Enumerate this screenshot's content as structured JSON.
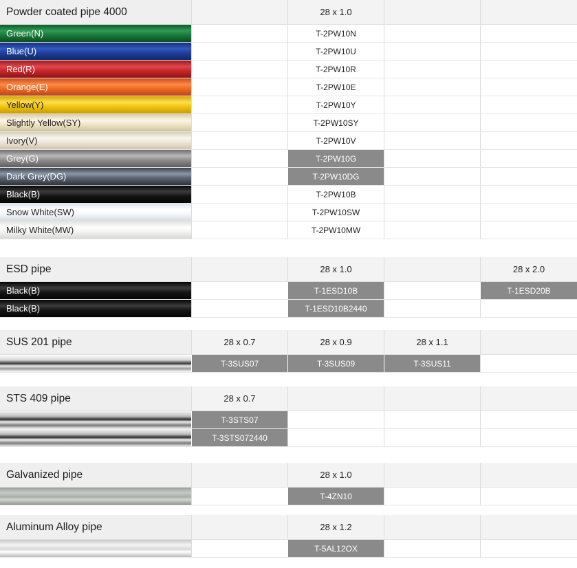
{
  "sections": {
    "powder": {
      "title": "Powder coated pipe 4000",
      "headers": [
        "",
        "28 x 1.0",
        "",
        ""
      ],
      "rows": [
        {
          "name": "Green(N)",
          "code": "T-2PW10N"
        },
        {
          "name": "Blue(U)",
          "code": "T-2PW10U"
        },
        {
          "name": "Red(R)",
          "code": "T-2PW10R"
        },
        {
          "name": "Orange(E)",
          "code": "T-2PW10E"
        },
        {
          "name": "Yellow(Y)",
          "code": "T-2PW10Y"
        },
        {
          "name": "Slightly Yellow(SY)",
          "code": "T-2PW10SY"
        },
        {
          "name": "Ivory(V)",
          "code": "T-2PW10V"
        },
        {
          "name": "Grey(G)",
          "code": "T-2PW10G"
        },
        {
          "name": "Dark Grey(DG)",
          "code": "T-2PW10DG"
        },
        {
          "name": "Black(B)",
          "code": "T-2PW10B"
        },
        {
          "name": "Snow White(SW)",
          "code": "T-2PW10SW"
        },
        {
          "name": "Milky White(MW)",
          "code": "T-2PW10MW"
        }
      ]
    },
    "esd": {
      "title": "ESD pipe",
      "headers": [
        "",
        "28 x 1.0",
        "",
        "28 x 2.0"
      ],
      "rows": [
        {
          "name": "Black(B)",
          "codes": [
            "",
            "T-1ESD10B",
            "",
            "T-1ESD20B"
          ]
        },
        {
          "name": "Black(B)",
          "codes": [
            "",
            "T-1ESD10B2440",
            "",
            ""
          ]
        }
      ]
    },
    "sus201": {
      "title": "SUS 201 pipe",
      "headers": [
        "28 x 0.7",
        "28 x 0.9",
        "28 x 1.1",
        ""
      ],
      "codes": [
        "T-3SUS07",
        "T-3SUS09",
        "T-3SUS11",
        ""
      ]
    },
    "sts409": {
      "title": "STS 409 pipe",
      "headers": [
        "28 x 0.7",
        "",
        "",
        ""
      ],
      "codes": [
        "T-3STS07",
        "T-3STS072440"
      ]
    },
    "galvanized": {
      "title": "Galvanized pipe",
      "headers": [
        "",
        "28 x 1.0",
        "",
        ""
      ],
      "code": "T-4ZN10"
    },
    "aluminum": {
      "title": "Aluminum Alloy pipe",
      "headers": [
        "",
        "28 x 1.2",
        "",
        ""
      ],
      "code": "T-5AL12OX"
    }
  },
  "colors": {
    "filled_cell": "#8a8a8a",
    "header_bg": "#efefef",
    "green": "#1f7a3e",
    "blue": "#1d3f9a",
    "red": "#c9262a",
    "orange": "#ef6a24",
    "yellow": "#f1c40f",
    "slightly_yellow": "#efe6c8",
    "ivory": "#ece6d6",
    "grey": "#8c8c8c",
    "dark_grey": "#5a6470",
    "black": "#151515",
    "snow_white": "#f6f8fb",
    "milky_white": "#f3f3f1"
  }
}
